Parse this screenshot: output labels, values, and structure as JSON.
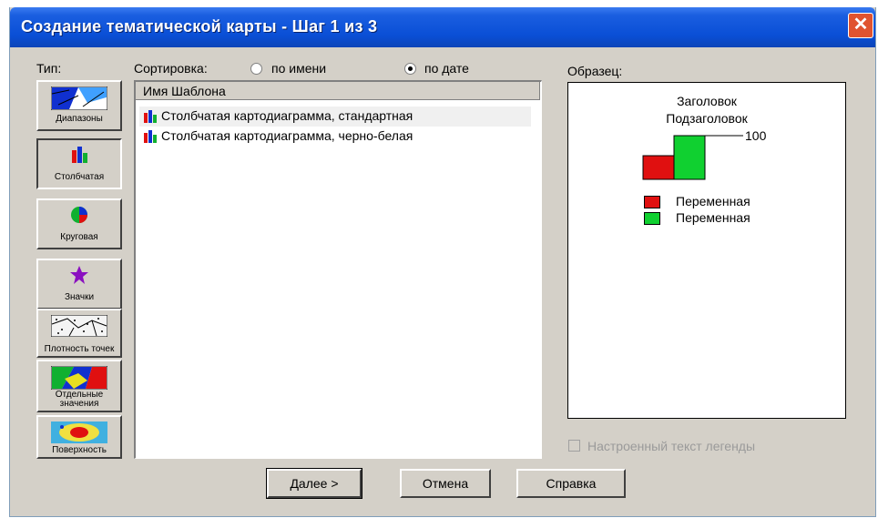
{
  "window": {
    "title": "Создание тематической карты - Шаг 1 из 3",
    "close_symbol": "✕"
  },
  "type_label": "Тип:",
  "sort": {
    "label": "Сортировка:",
    "by_name": "по имени",
    "by_date": "по дате",
    "selected": "by_date"
  },
  "map_types": [
    {
      "label": "Диапазоны",
      "icon": "ranges-icon"
    },
    {
      "label": "Столбчатая",
      "icon": "bar-chart-icon"
    },
    {
      "label": "Круговая",
      "icon": "pie-chart-icon"
    },
    {
      "label": "Значки",
      "icon": "star-icon"
    },
    {
      "label": "Плотность точек",
      "icon": "dot-density-icon"
    },
    {
      "label": "Отдельные значения",
      "icon": "individual-values-icon"
    },
    {
      "label": "Поверхность",
      "icon": "surface-icon"
    }
  ],
  "template_list": {
    "header": "Имя Шаблона",
    "items": [
      "Столбчатая картодиаграмма, стандартная",
      "Столбчатая картодиаграмма, черно-белая"
    ]
  },
  "sample": {
    "label": "Образец:",
    "title": "Заголовок",
    "subtitle": "Подзаголовок",
    "value_label": "100",
    "legend": [
      {
        "label": "Переменная",
        "color": "#e01010"
      },
      {
        "label": "Переменная",
        "color": "#10d030"
      }
    ]
  },
  "custom_legend_checkbox": "Настроенный текст легенды",
  "buttons": {
    "next": "Далее >",
    "cancel": "Отмена",
    "help": "Справка"
  }
}
